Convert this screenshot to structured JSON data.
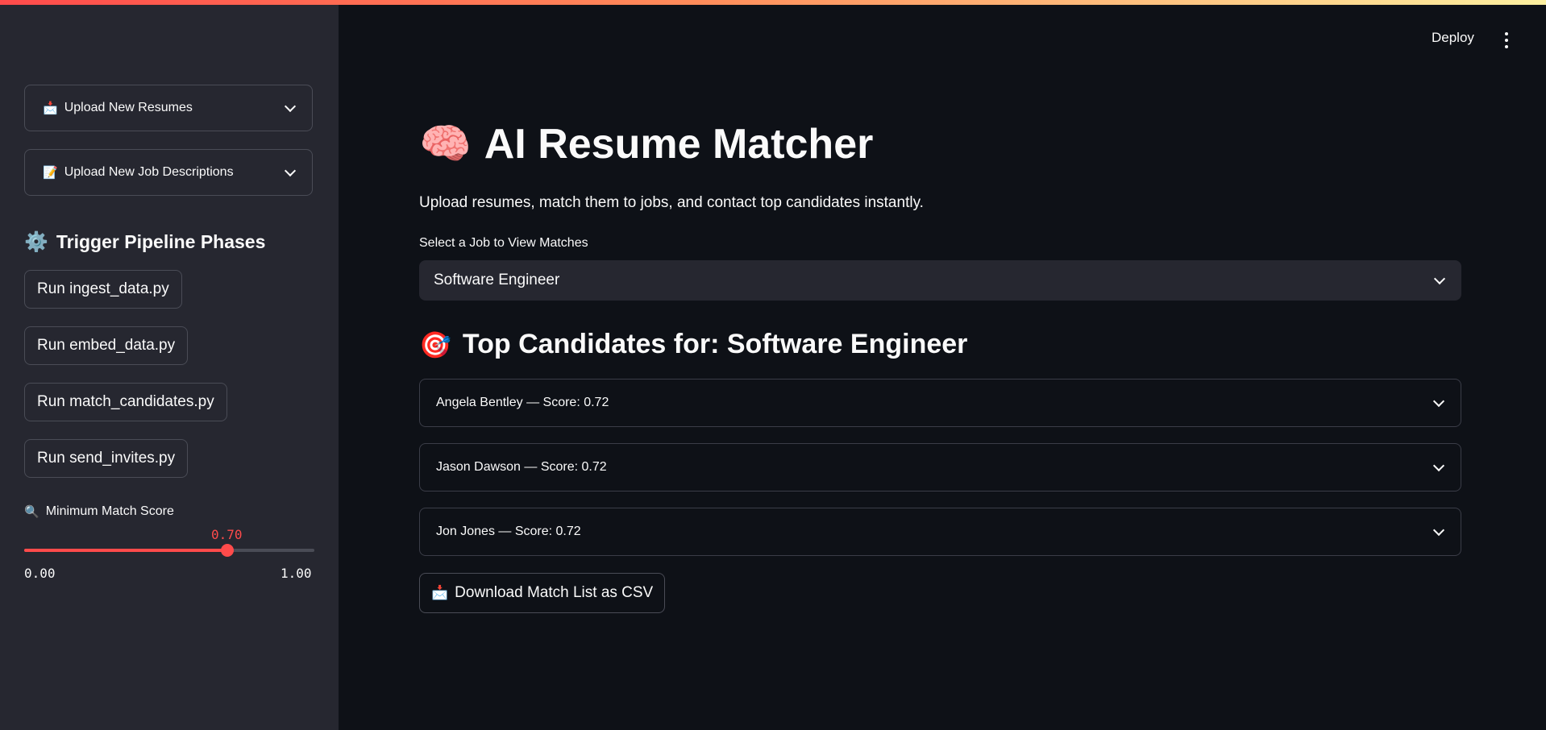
{
  "header": {
    "deploy_label": "Deploy",
    "menu_icon": "kebab-menu-icon"
  },
  "sidebar": {
    "expanders": [
      {
        "icon": "📩",
        "label": "Upload New Resumes"
      },
      {
        "icon": "📝",
        "label": "Upload New Job Descriptions"
      }
    ],
    "heading": {
      "icon": "⚙️",
      "label": "Trigger Pipeline Phases"
    },
    "buttons": [
      {
        "label": "Run ingest_data.py"
      },
      {
        "label": "Run embed_data.py"
      },
      {
        "label": "Run match_candidates.py"
      },
      {
        "label": "Run send_invites.py"
      }
    ],
    "slider": {
      "icon": "🔍",
      "label": "Minimum Match Score",
      "value": 0.7,
      "value_text": "0.70",
      "min_text": "0.00",
      "max_text": "1.00",
      "accent": "#ff4b4b"
    }
  },
  "main": {
    "title_icon": "🧠",
    "title": "AI Resume Matcher",
    "subtitle": "Upload resumes, match them to jobs, and contact top candidates instantly.",
    "select_label": "Select a Job to View Matches",
    "selected_job": "Software Engineer",
    "section_icon": "🎯",
    "section_title": "Top Candidates for: Software Engineer",
    "candidates": [
      {
        "label": "Angela Bentley — Score: 0.72"
      },
      {
        "label": "Jason Dawson — Score: 0.72"
      },
      {
        "label": "Jon Jones — Score: 0.72"
      }
    ],
    "download_icon": "📩",
    "download_label": "Download Match List as CSV"
  },
  "colors": {
    "background": "#0e1117",
    "sidebar": "#262730",
    "accent": "#ff4b4b"
  }
}
